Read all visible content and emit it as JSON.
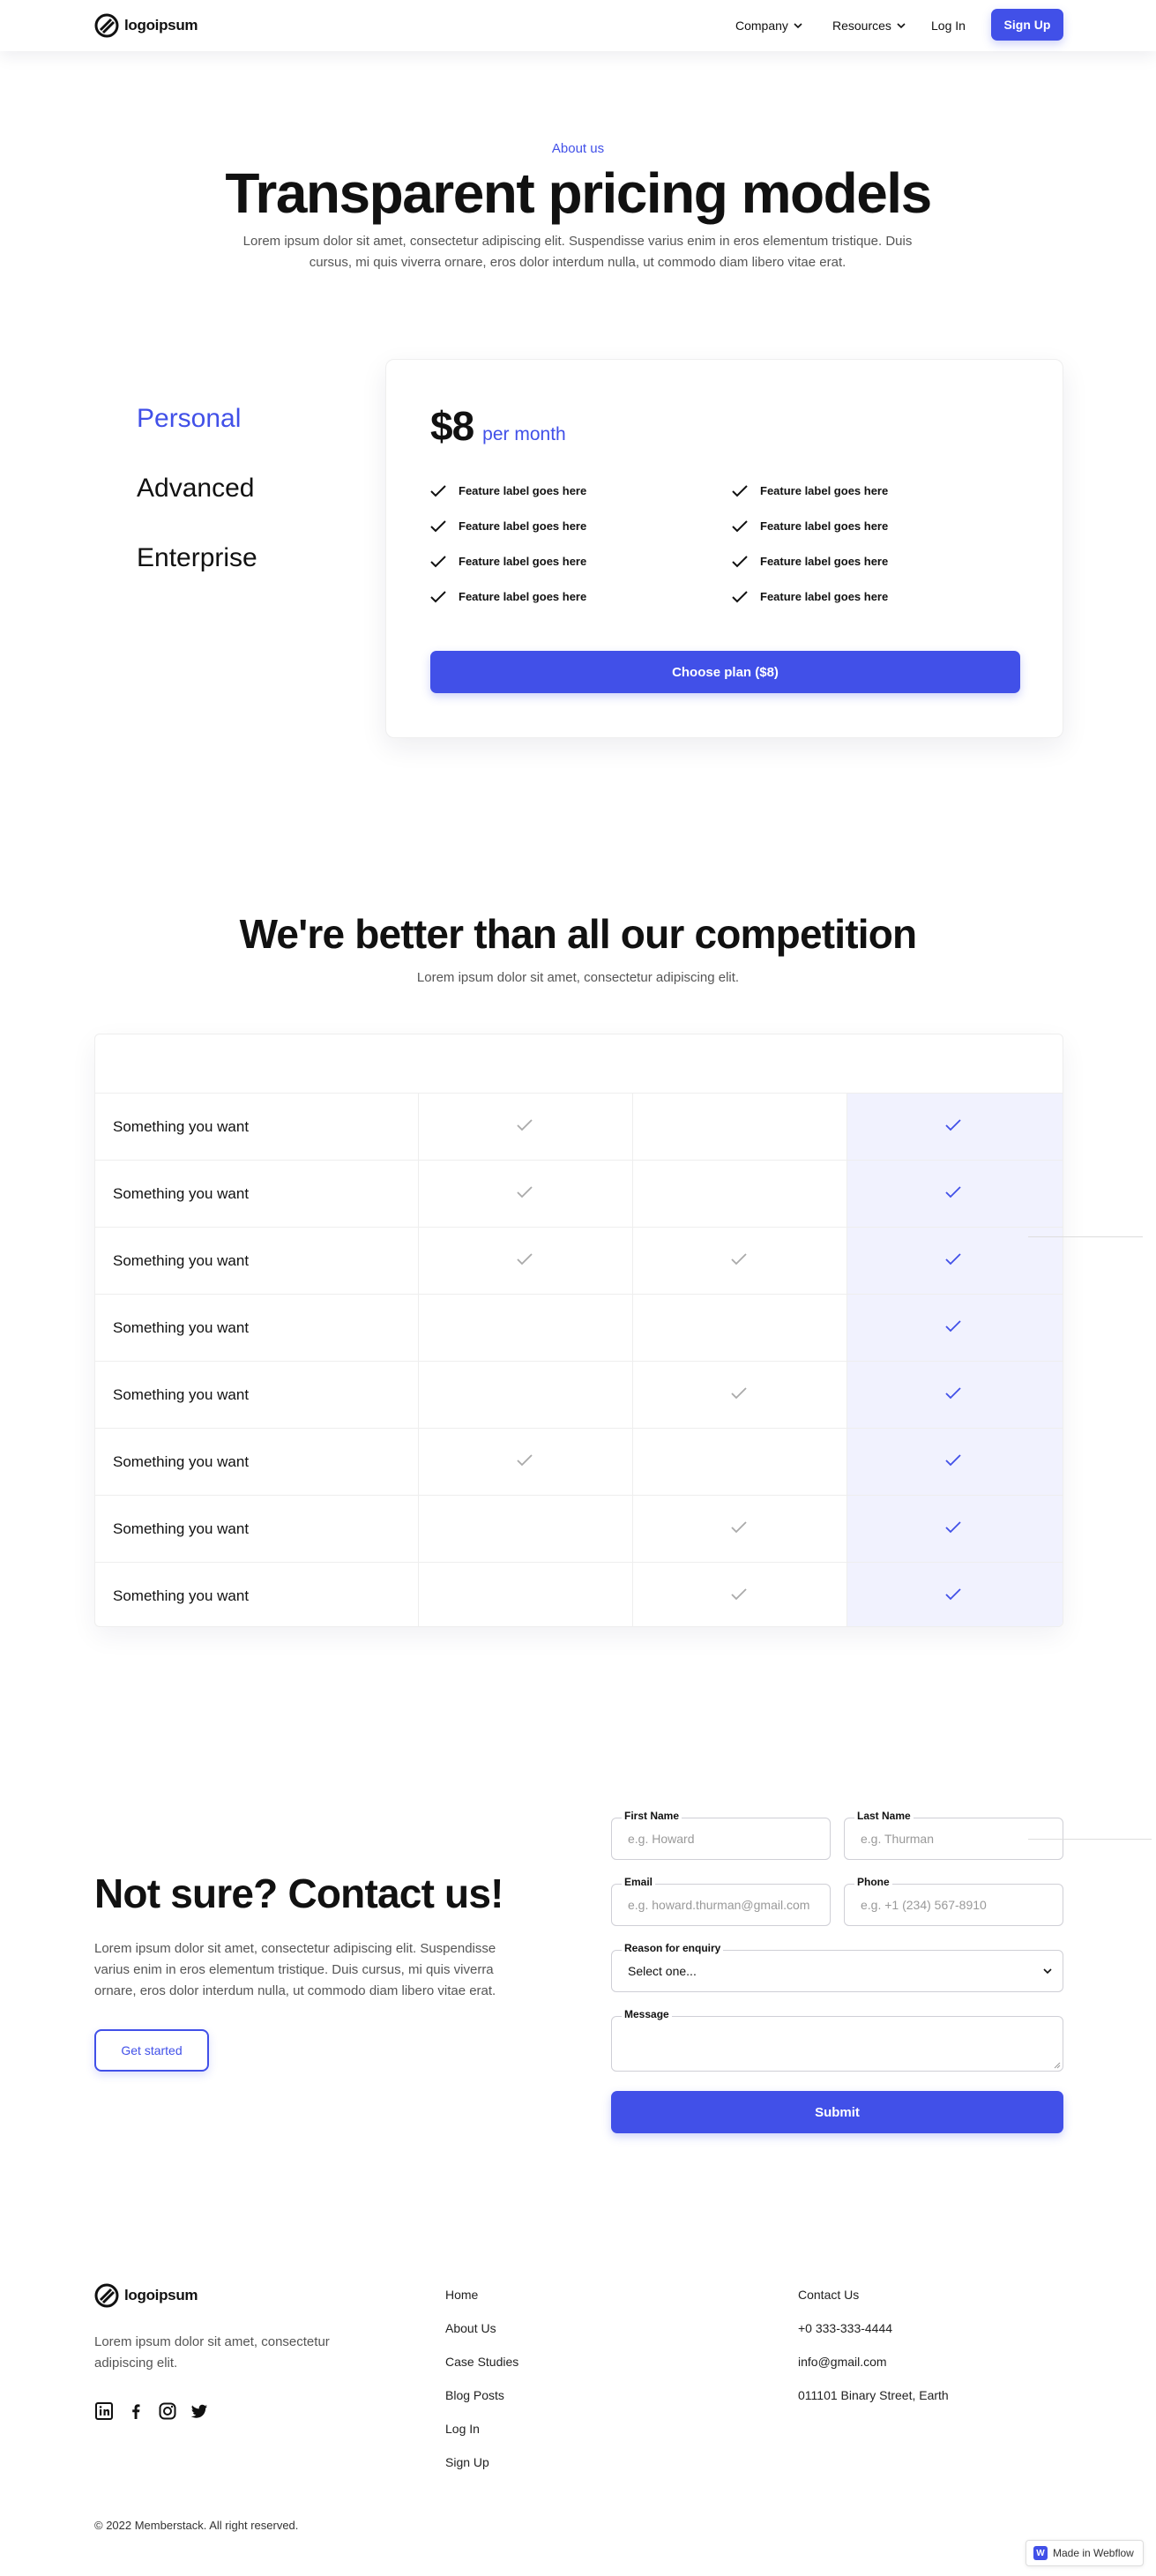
{
  "nav": {
    "logo_text": "logoipsum",
    "company": "Company",
    "resources": "Resources",
    "login": "Log In",
    "signup": "Sign Up"
  },
  "hero": {
    "eyebrow": "About us",
    "title": "Transparent pricing models",
    "subtitle": "Lorem ipsum dolor sit amet, consectetur adipiscing elit. Suspendisse varius enim in eros elementum tristique. Duis cursus, mi quis viverra ornare, eros dolor interdum nulla, ut commodo diam libero vitae erat."
  },
  "plans": {
    "tabs": [
      "Personal",
      "Advanced",
      "Enterprise"
    ],
    "active_tab": "Personal",
    "price": "$8",
    "period": "per month",
    "features": [
      "Feature label goes here",
      "Feature label goes here",
      "Feature label goes here",
      "Feature label goes here",
      "Feature label goes here",
      "Feature label goes here",
      "Feature label goes here",
      "Feature label goes here"
    ],
    "cta": "Choose plan ($8)"
  },
  "competition": {
    "title": "We're better than all our competition",
    "subtitle": "Lorem ipsum dolor sit amet, consectetur adipiscing elit.",
    "rows": [
      {
        "label": "Something you want",
        "c1": true,
        "c2": false,
        "c3": true
      },
      {
        "label": "Something you want",
        "c1": true,
        "c2": false,
        "c3": true
      },
      {
        "label": "Something you want",
        "c1": true,
        "c2": true,
        "c3": true
      },
      {
        "label": "Something you want",
        "c1": false,
        "c2": false,
        "c3": true
      },
      {
        "label": "Something you want",
        "c1": false,
        "c2": true,
        "c3": true
      },
      {
        "label": "Something you want",
        "c1": true,
        "c2": false,
        "c3": true
      },
      {
        "label": "Something you want",
        "c1": false,
        "c2": true,
        "c3": true
      },
      {
        "label": "Something you want",
        "c1": false,
        "c2": true,
        "c3": true
      }
    ]
  },
  "contact": {
    "title": "Not sure? Contact us!",
    "text": "Lorem ipsum dolor sit amet, consectetur adipiscing elit. Suspendisse varius enim in eros elementum tristique. Duis cursus, mi quis viverra ornare, eros dolor interdum nulla, ut commodo diam libero vitae erat.",
    "cta": "Get started",
    "first_name_label": "First Name",
    "first_name_placeholder": "e.g. Howard",
    "last_name_label": "Last Name",
    "last_name_placeholder": "e.g. Thurman",
    "email_label": "Email",
    "email_placeholder": "e.g. howard.thurman@gmail.com",
    "phone_label": "Phone",
    "phone_placeholder": "e.g. +1 (234) 567-8910",
    "reason_label": "Reason for enquiry",
    "reason_value": "Select one...",
    "message_label": "Message",
    "submit": "Submit"
  },
  "footer": {
    "logo_text": "logoipsum",
    "text": "Lorem ipsum dolor sit amet, consectetur adipiscing elit.",
    "social_icons": [
      "linkedin-icon",
      "facebook-icon",
      "instagram-icon",
      "twitter-icon"
    ],
    "links": [
      "Home",
      "About Us",
      "Case Studies",
      "Blog Posts",
      "Log In",
      "Sign Up"
    ],
    "contact_heading": "Contact Us",
    "phone": "+0 333-333-4444",
    "email": "info@gmail.com",
    "address": "011101 Binary Street, Earth",
    "copyright": "© 2022 Memberstack. All right reserved.",
    "badge": "Made in Webflow"
  },
  "colors": {
    "accent": "#4150e8",
    "highlight_column": "#f1f2fe"
  }
}
